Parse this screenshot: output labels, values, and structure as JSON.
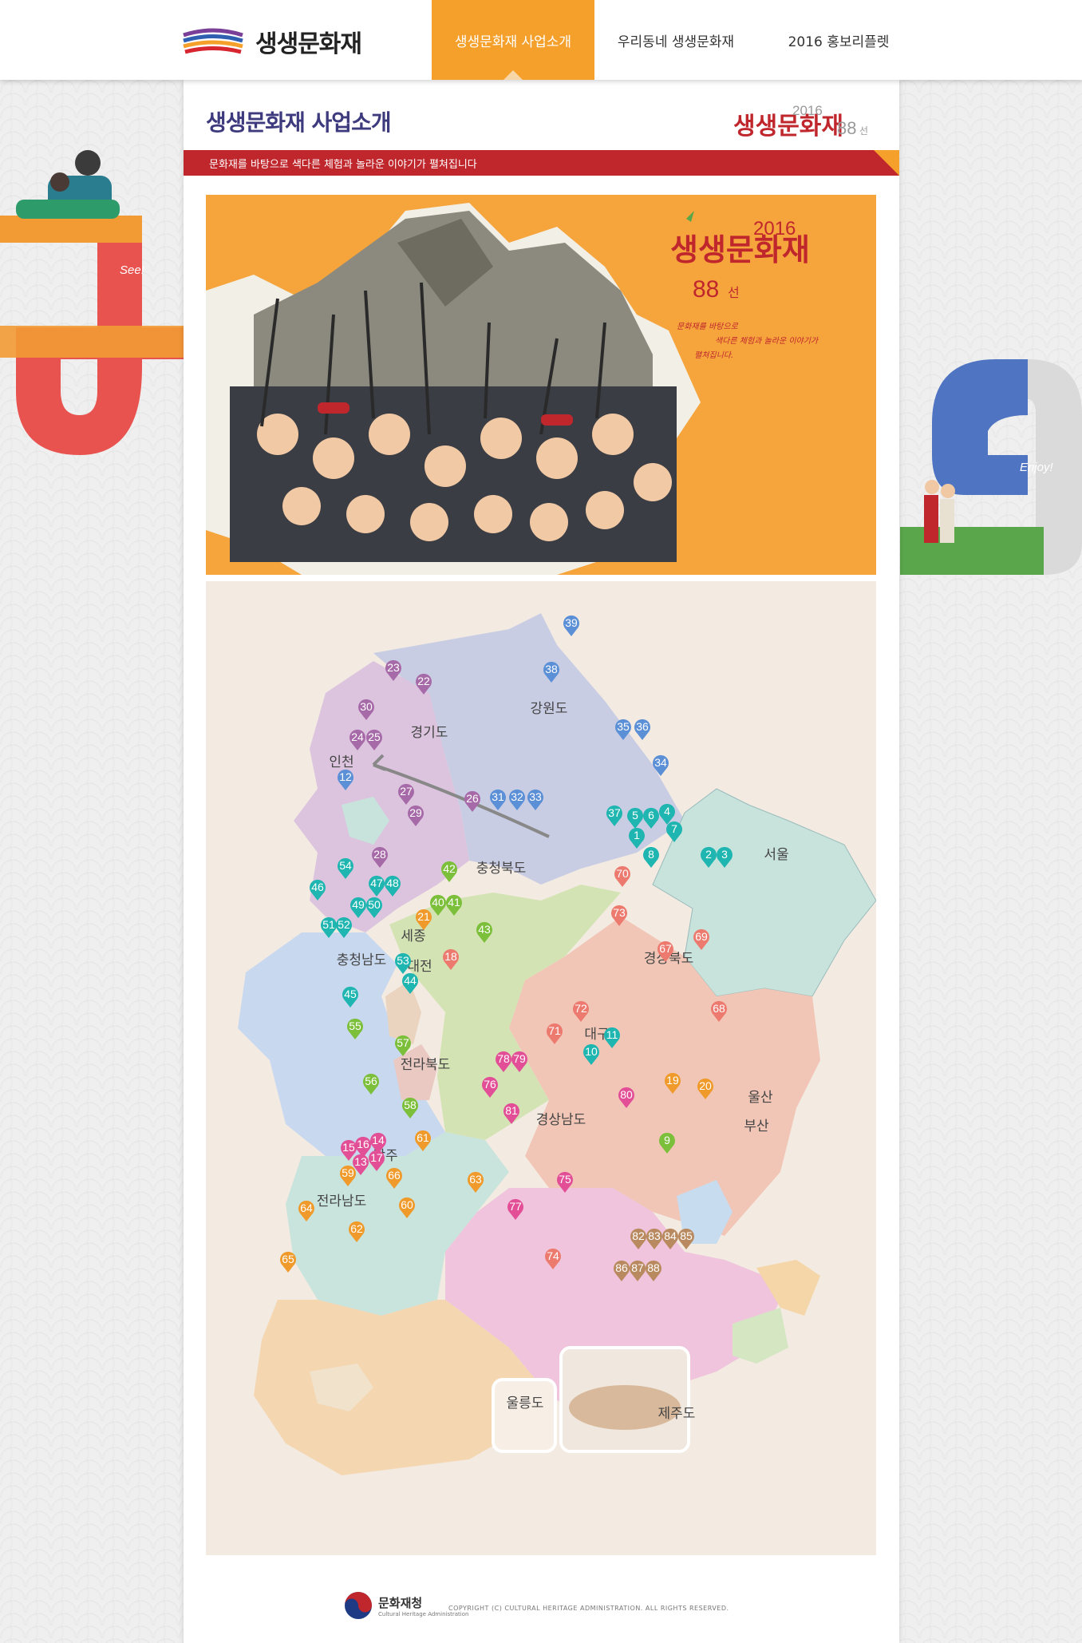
{
  "header": {
    "logo_text": "생생문화재",
    "nav": [
      {
        "label": "생생문화재 사업소개",
        "active": true
      },
      {
        "label": "우리동네 생생문화재",
        "active": false
      },
      {
        "label": "2016 홍보리플렛",
        "active": false
      }
    ]
  },
  "page": {
    "title": "생생문화재 사업소개",
    "brand_mini": {
      "main": "생생문화재",
      "year": "2016",
      "count": "88",
      "unit": "선"
    },
    "tagline": "문화재를 바탕으로 색다른 체험과 놀라운 이야기가 펼쳐집니다"
  },
  "hero": {
    "brand_main": "생생문화재",
    "year": "2016",
    "count": "88",
    "unit": "선",
    "handwriting_1": "문화재를 바탕으로",
    "handwriting_2": "색다른 체험과 놀라운 이야기가",
    "handwriting_3": "펼쳐집니다."
  },
  "decor": {
    "left_word": "See!",
    "right_word": "Enjoy!"
  },
  "map": {
    "regions": [
      {
        "name": "강원도",
        "color": "#c9cde4"
      },
      {
        "name": "경기도",
        "color": "#dcc4df"
      },
      {
        "name": "인천",
        "color": "#dcc4df"
      },
      {
        "name": "서울",
        "color": "#c8e2dc"
      },
      {
        "name": "충청북도",
        "color": "#d4e3b4"
      },
      {
        "name": "충청남도",
        "color": "#c8d8ef"
      },
      {
        "name": "세종",
        "color": "#ead3bf"
      },
      {
        "name": "대전",
        "color": "#e9c9c2"
      },
      {
        "name": "경상북도",
        "color": "#f1c6b6"
      },
      {
        "name": "대구",
        "color": "#c8dcef"
      },
      {
        "name": "전라북도",
        "color": "#c9e4dc"
      },
      {
        "name": "경상남도",
        "color": "#efc4dc"
      },
      {
        "name": "울산",
        "color": "#f4d6a8"
      },
      {
        "name": "부산",
        "color": "#d4e6c2"
      },
      {
        "name": "광주",
        "color": "#f1e2cc"
      },
      {
        "name": "전라남도",
        "color": "#f4d6b1"
      },
      {
        "name": "울릉도",
        "color": "#f7efe6"
      },
      {
        "name": "제주도",
        "color": "#d9b99b"
      }
    ],
    "pins_blue": [
      "39",
      "38",
      "35",
      "36",
      "34",
      "12",
      "31",
      "32",
      "33"
    ],
    "pins_purple": [
      "23",
      "22",
      "30",
      "24",
      "25",
      "27",
      "29",
      "26",
      "28"
    ],
    "pins_teal": [
      "37",
      "5",
      "6",
      "4",
      "7",
      "1",
      "8",
      "2",
      "3",
      "54",
      "46",
      "47",
      "48",
      "49",
      "50",
      "51",
      "52",
      "53",
      "44",
      "45",
      "10",
      "11"
    ],
    "pins_green": [
      "42",
      "40",
      "41",
      "43",
      "9",
      "55",
      "57",
      "56",
      "58"
    ],
    "pins_orange": [
      "21",
      "18",
      "70",
      "73",
      "69",
      "67",
      "68",
      "72",
      "71",
      "19",
      "20",
      "61",
      "59",
      "66",
      "63",
      "64",
      "62",
      "60",
      "65"
    ],
    "pins_pink": [
      "78",
      "79",
      "76",
      "81",
      "80",
      "75",
      "77",
      "15",
      "16",
      "14",
      "13",
      "17",
      "74"
    ],
    "pins_brown": [
      "82",
      "83",
      "84",
      "85",
      "86",
      "87",
      "88"
    ]
  },
  "footer": {
    "org": "문화재청",
    "org_en": "Cultural Heritage Administration",
    "copyright": "COPYRIGHT (C) CULTURAL HERITAGE ADMINISTRATION. ALL RIGHTS RESERVED."
  }
}
